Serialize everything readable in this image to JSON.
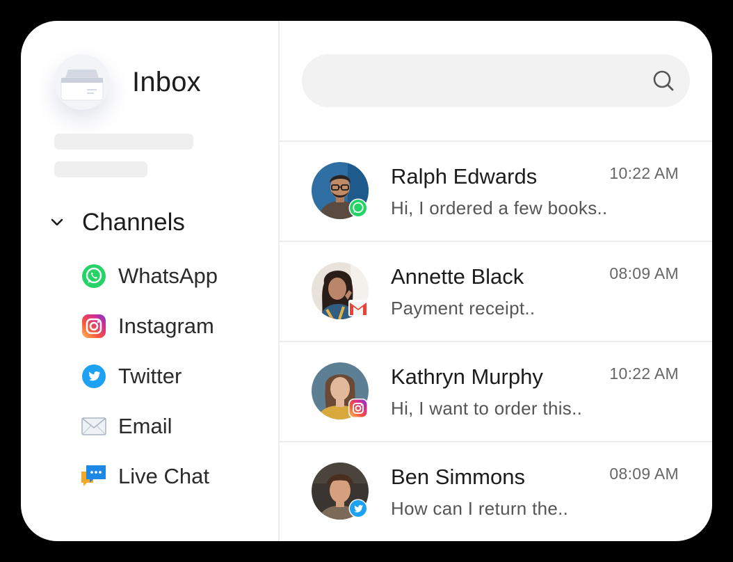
{
  "sidebar": {
    "title": "Inbox",
    "inbox_icon": "inbox-tray-icon",
    "section": {
      "title": "Channels",
      "expanded": true,
      "chevron_icon": "chevron-down-icon"
    },
    "channels": [
      {
        "label": "WhatsApp",
        "icon": "whatsapp-icon",
        "color": "#25D366"
      },
      {
        "label": "Instagram",
        "icon": "instagram-icon",
        "color": "#E1306C"
      },
      {
        "label": "Twitter",
        "icon": "twitter-icon",
        "color": "#1DA1F2"
      },
      {
        "label": "Email",
        "icon": "envelope-icon",
        "color": "#AAB4C0"
      },
      {
        "label": "Live Chat",
        "icon": "live-chat-icon",
        "color": "#1E88E5"
      }
    ]
  },
  "search": {
    "value": "",
    "placeholder": "",
    "icon": "search-icon"
  },
  "conversations": [
    {
      "name": "Ralph Edwards",
      "time": "10:22 AM",
      "preview": "Hi, I ordered a few books..",
      "channel_badge": "whatsapp-icon"
    },
    {
      "name": "Annette Black",
      "time": "08:09 AM",
      "preview": "Payment receipt..",
      "channel_badge": "gmail-icon"
    },
    {
      "name": "Kathryn Murphy",
      "time": "10:22 AM",
      "preview": "Hi, I want to order this..",
      "channel_badge": "instagram-icon"
    },
    {
      "name": "Ben Simmons",
      "time": "08:09 AM",
      "preview": "How can I return the..",
      "channel_badge": "twitter-icon"
    }
  ]
}
